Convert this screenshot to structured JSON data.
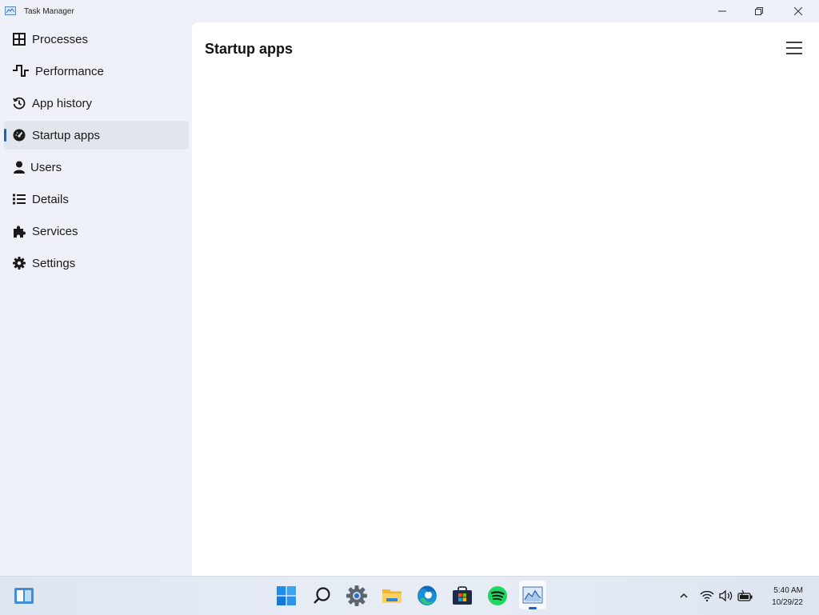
{
  "window": {
    "title": "Task Manager"
  },
  "sidebar": {
    "items": [
      {
        "label": "Processes",
        "icon": "processes-grid-icon"
      },
      {
        "label": "Performance",
        "icon": "performance-pulse-icon"
      },
      {
        "label": "App history",
        "icon": "history-clock-icon"
      },
      {
        "label": "Startup apps",
        "icon": "startup-gauge-icon",
        "active": true
      },
      {
        "label": "Users",
        "icon": "user-icon"
      },
      {
        "label": "Details",
        "icon": "details-list-icon"
      },
      {
        "label": "Services",
        "icon": "services-puzzle-icon"
      },
      {
        "label": "Settings",
        "icon": "gear-icon"
      }
    ]
  },
  "main": {
    "title": "Startup apps"
  },
  "taskbar": {
    "pinned": [
      "widgets-icon",
      "start-icon",
      "search-icon",
      "settings-icon",
      "file-explorer-icon",
      "edge-icon",
      "store-icon",
      "spotify-icon",
      "task-manager-icon"
    ],
    "tray": [
      "chevron-up-icon",
      "wifi-icon",
      "volume-icon",
      "battery-icon"
    ],
    "clock": {
      "time": "5:40 AM",
      "date": "10/29/22"
    }
  },
  "colors": {
    "accent": "#1464c8",
    "sidebar_bg": "#eef2f8",
    "content_bg": "#ffffff",
    "active_item_bg": "#e1e5ec"
  }
}
